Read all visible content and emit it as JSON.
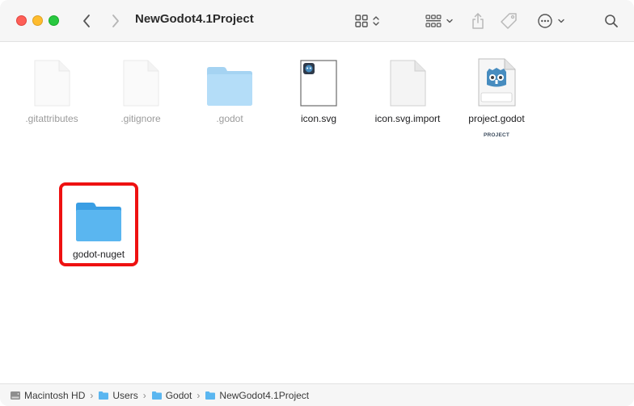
{
  "window": {
    "title": "NewGodot4.1Project"
  },
  "toolbar": {
    "back_icon": "chevron-left-icon",
    "forward_icon": "chevron-right-icon",
    "view_icon": "grid-view-icon",
    "group_icon": "group-by-icon",
    "share_icon": "share-icon",
    "tag_icon": "tag-icon",
    "more_icon": "ellipsis-circle-icon",
    "search_icon": "search-icon"
  },
  "files": [
    {
      "name": ".gitattributes",
      "kind": "document",
      "hidden": true
    },
    {
      "name": ".gitignore",
      "kind": "document",
      "hidden": true
    },
    {
      "name": ".godot",
      "kind": "folder",
      "hidden": true
    },
    {
      "name": "icon.svg",
      "kind": "svg-image",
      "hidden": false
    },
    {
      "name": "icon.svg.import",
      "kind": "document",
      "hidden": false
    },
    {
      "name": "project.godot",
      "kind": "godot-project",
      "hidden": false,
      "badge": "PROJECT"
    },
    {
      "name": "godot-nuget",
      "kind": "folder",
      "hidden": false,
      "highlighted": true
    }
  ],
  "pathbar": {
    "items": [
      "Macintosh HD",
      "Users",
      "Godot",
      "NewGodot4.1Project"
    ],
    "separator": "›"
  },
  "colors": {
    "folder": "#5ab6f0",
    "highlight": "#ee1111",
    "godot_blue": "#478cbf"
  }
}
